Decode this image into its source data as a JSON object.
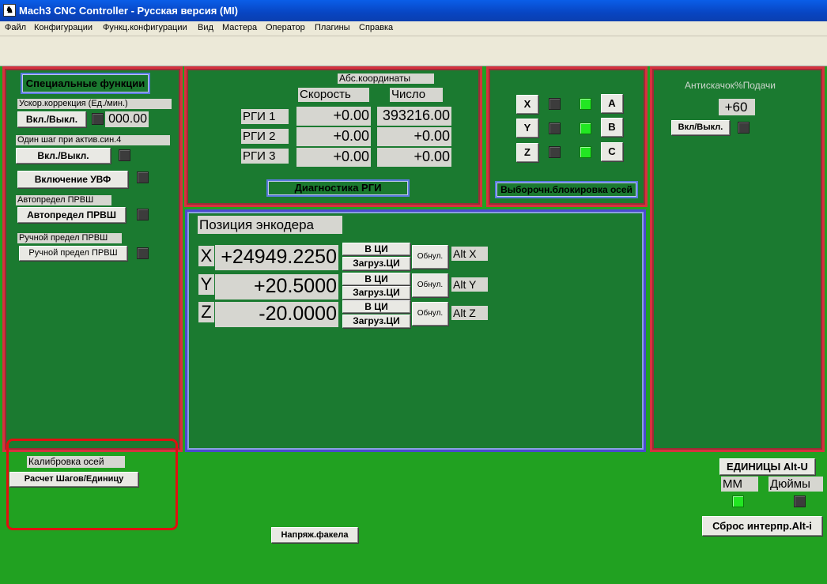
{
  "window": {
    "title": "Mach3 CNC Controller - Русская версия (MI)",
    "icon": "mach3-app-icon"
  },
  "menu": [
    "Файл",
    "Конфигурации",
    "Функц.конфигурации",
    "Вид",
    "Мастера",
    "Оператор",
    "Плагины",
    "Справка"
  ],
  "special": {
    "title": "Специальные функции",
    "accel_label": "Ускор.коррекция (Ед./мин.)",
    "accel_btn": "Вкл./Выкл.",
    "accel_value": "000.00",
    "single_step_label": "Один шаг при актив.син.4",
    "single_step_btn": "Вкл./Выкл.",
    "uvf_btn": "Включение УВФ",
    "auto_prvsh_label": "Автопредел ПРВШ",
    "auto_prvsh_btn": "Автопредел ПРВШ",
    "manual_prvsh_label": "Ручной предел ПРВШ",
    "manual_prvsh_btn": "Ручной предел ПРВШ"
  },
  "rgi": {
    "abs_label": "Абс.координаты",
    "speed_header": "Скорость",
    "count_header": "Число",
    "rows": [
      {
        "name": "РГИ 1",
        "speed": "+0.00",
        "count": "393216.00"
      },
      {
        "name": "РГИ 2",
        "speed": "+0.00",
        "count": "+0.00"
      },
      {
        "name": "РГИ 3",
        "speed": "+0.00",
        "count": "+0.00"
      }
    ],
    "diag_btn": "Диагностика РГИ"
  },
  "axis_lock": {
    "axes": [
      "X",
      "Y",
      "Z",
      "A",
      "B",
      "C"
    ],
    "title_btn": "Выборочн.блокировка осей"
  },
  "anti_backlash": {
    "label": "Антискачок%Подачи",
    "value": "+60",
    "btn": "Вкл/Выкл."
  },
  "encoder": {
    "title": "Позиция энкодера",
    "rows": [
      {
        "axis": "X",
        "value": "+24949.2250",
        "to_dro": "В ЦИ",
        "load_dro": "Загруз.ЦИ",
        "zero": "Обнул.",
        "alt": "Alt X"
      },
      {
        "axis": "Y",
        "value": "+20.5000",
        "to_dro": "В ЦИ",
        "load_dro": "Загруз.ЦИ",
        "zero": "Обнул.",
        "alt": "Alt Y"
      },
      {
        "axis": "Z",
        "value": "-20.0000",
        "to_dro": "В ЦИ",
        "load_dro": "Загруз.ЦИ",
        "zero": "Обнул.",
        "alt": "Alt Z"
      }
    ]
  },
  "calibration": {
    "label": "Калибровка осей",
    "btn": "Расчет Шагов/Единицу"
  },
  "torch_btn": "Напряж.факела",
  "units": {
    "btn": "ЕДИНИЦЫ Alt-U",
    "mm": "ММ",
    "inch": "Дюймы"
  },
  "reset_btn": "Сброс интерпр.Alt-i",
  "colors": {
    "background": "#21a121",
    "panel": "#1b7a30",
    "panel_border": "#d6323e",
    "led_on": "#22e622",
    "highlight": "#e01010"
  }
}
